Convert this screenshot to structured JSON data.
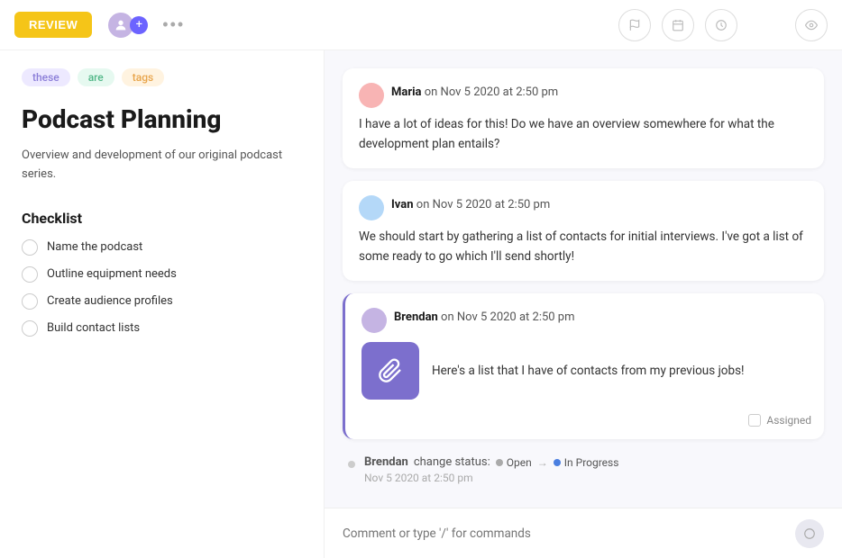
{
  "topbar": {
    "review_label": "REVIEW",
    "more_label": "•••"
  },
  "left": {
    "tags": [
      {
        "label": "these",
        "class": "tag-purple"
      },
      {
        "label": "are",
        "class": "tag-green"
      },
      {
        "label": "tags",
        "class": "tag-orange"
      }
    ],
    "title": "Podcast Planning",
    "description": "Overview and development of our original podcast series.",
    "checklist_title": "Checklist",
    "checklist_items": [
      "Name the podcast",
      "Outline equipment needs",
      "Create audience profiles",
      "Build contact lists"
    ]
  },
  "right": {
    "comments": [
      {
        "id": "maria",
        "author": "Maria",
        "timestamp": "on Nov 5 2020 at 2:50 pm",
        "text": "I have a lot of ideas for this! Do we have an overview somewhere for what the development plan entails?",
        "highlighted": false
      },
      {
        "id": "ivan",
        "author": "Ivan",
        "timestamp": "on Nov 5 2020 at 2:50 pm",
        "text": "We should start by gathering a list of contacts for initial interviews. I've got a list of some ready to go which I'll send shortly!",
        "highlighted": false
      }
    ],
    "attachment_comment": {
      "author": "Brendan",
      "timestamp": "on Nov 5 2020 at 2:50 pm",
      "text": "Here's a list that I have of contacts from my previous jobs!",
      "assigned_label": "Assigned"
    },
    "status_change": {
      "author": "Brendan",
      "prefix": "change status:",
      "from": "Open",
      "to": "In Progress",
      "date": "Nov 5 2020 at 2:50 pm"
    },
    "input_placeholder": "Comment or type '/' for commands"
  }
}
